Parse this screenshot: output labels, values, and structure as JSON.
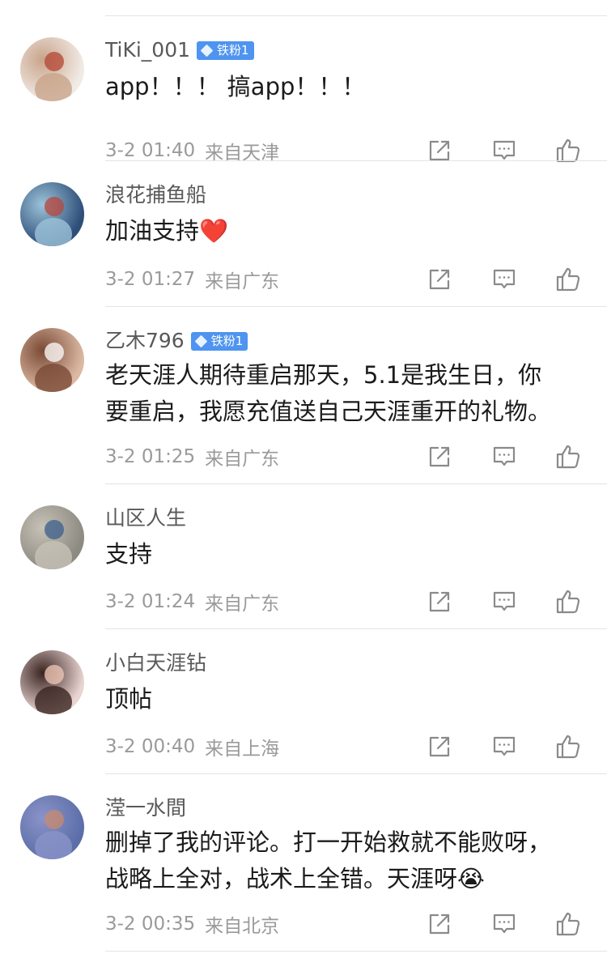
{
  "comments": [
    {
      "username": "TiKi_001",
      "badge": "铁粉1",
      "lines": [
        "app！！！ 搞app！！！"
      ],
      "date": "3-2 01:40",
      "location": "来自天津",
      "avatar_colors": [
        "#f1ebe6",
        "#c9a48a",
        "#b44433"
      ]
    },
    {
      "username": "浪花捕鱼船",
      "badge": "",
      "lines": [
        "加油支持❤️"
      ],
      "date": "3-2 01:27",
      "location": "来自广东",
      "avatar_colors": [
        "#2e4e78",
        "#9cc3d9",
        "#b8453b"
      ]
    },
    {
      "username": "乙木796",
      "badge": "铁粉1",
      "lines": [
        "老天涯人期待重启那天，5.1是我生日，你",
        "要重启，我愿充值送自己天涯重开的礼物。"
      ],
      "date": "3-2 01:25",
      "location": "来自广东",
      "avatar_colors": [
        "#dcb9a3",
        "#7a4a36",
        "#ffffff"
      ]
    },
    {
      "username": "山区人生",
      "badge": "",
      "lines": [
        "支持"
      ],
      "date": "3-2 01:24",
      "location": "来自广东",
      "avatar_colors": [
        "#8d8a82",
        "#c7c2b6",
        "#3c5e8c"
      ]
    },
    {
      "username": "小白天涯钻",
      "badge": "",
      "lines": [
        "顶帖"
      ],
      "date": "3-2 00:40",
      "location": "来自上海",
      "avatar_colors": [
        "#e9d4d2",
        "#3a2420",
        "#f3c9b9"
      ]
    },
    {
      "username": "滢一水間",
      "badge": "",
      "lines": [
        "删掉了我的评论。打一开始救就不能败呀，",
        "战略上全对，战术上全错。天涯呀😭"
      ],
      "date": "3-2 00:35",
      "location": "来自北京",
      "avatar_colors": [
        "#5c6ea8",
        "#8a93c9",
        "#c98a6e"
      ]
    }
  ],
  "actions": {
    "share_icon": "share-icon",
    "reply_icon": "comment-icon",
    "like_icon": "thumbs-up-icon"
  },
  "colors": {
    "badge": "#4e94f0",
    "icon": "#8a8a8a",
    "divider": "#e4e4e4",
    "meta_text": "#9a9a9a"
  }
}
